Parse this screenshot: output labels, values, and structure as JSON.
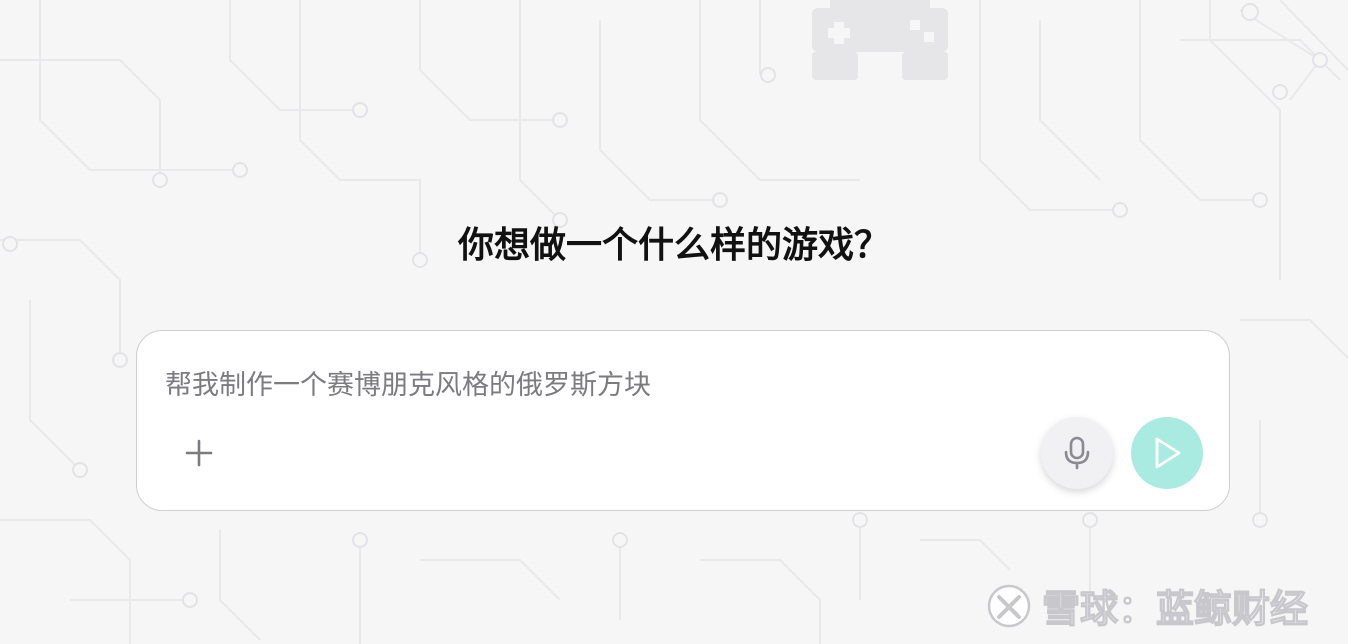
{
  "heading": "你想做一个什么样的游戏？",
  "prompt": {
    "text": "帮我制作一个赛博朋克风格的俄罗斯方块"
  },
  "actions": {
    "add_icon": "plus-icon",
    "mic_icon": "microphone-icon",
    "send_icon": "play-send-icon"
  },
  "watermark": {
    "text": "雪球：蓝鲸财经"
  },
  "colors": {
    "background": "#f6f6f7",
    "heading": "#111111",
    "prompt_text": "#7b7b80",
    "send_button": "#a9ebe0",
    "mic_button": "#f1f1f3"
  }
}
